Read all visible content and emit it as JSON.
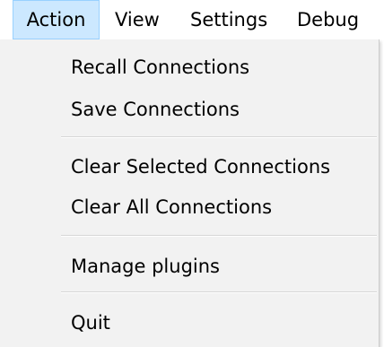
{
  "menubar": {
    "items": [
      {
        "label": "Action"
      },
      {
        "label": "View"
      },
      {
        "label": "Settings"
      },
      {
        "label": "Debug"
      }
    ]
  },
  "action_menu": {
    "items": [
      {
        "label": "Recall Connections"
      },
      {
        "label": "Save Connections"
      },
      {
        "label": "Clear Selected Connections"
      },
      {
        "label": "Clear All Connections"
      },
      {
        "label": "Manage plugins"
      },
      {
        "label": "Quit"
      }
    ]
  },
  "colors": {
    "menubar_active_bg": "#cce8ff",
    "menubar_active_border": "#99d1ff",
    "dropdown_bg": "#f2f2f2",
    "separator": "#d7d7d7"
  }
}
